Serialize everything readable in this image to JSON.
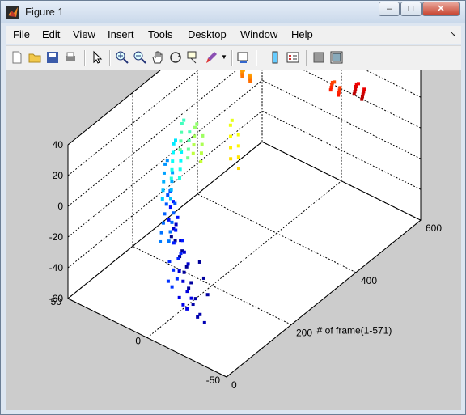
{
  "window": {
    "title": "Figure 1",
    "minimize": "–",
    "maximize": "□",
    "close": "✕"
  },
  "menu": [
    "File",
    "Edit",
    "View",
    "Insert",
    "Tools",
    "Desktop",
    "Window",
    "Help"
  ],
  "toolbar": [
    "new-figure-icon",
    "open-file-icon",
    "save-icon",
    "print-icon",
    "pointer-icon",
    "zoom-in-icon",
    "zoom-out-icon",
    "pan-icon",
    "rotate-3d-icon",
    "data-cursor-icon",
    "brush-icon",
    "link-plot-icon",
    "colorbar-icon",
    "legend-icon",
    "hide-plot-tools-icon",
    "show-plot-tools-icon"
  ],
  "chart_data": {
    "type": "scatter",
    "title": "",
    "xlabel": "# of frame(1-571)",
    "ylabel": "",
    "zlabel": "",
    "x_ticks": [
      "0",
      "200",
      "400",
      "600"
    ],
    "y_ticks": [
      "-50",
      "0",
      "50"
    ],
    "z_ticks": [
      "-60",
      "-40",
      "-20",
      "0",
      "20",
      "40"
    ],
    "xlim": [
      0,
      600
    ],
    "ylim": [
      -50,
      50
    ],
    "zlim": [
      -60,
      40
    ],
    "grid": true,
    "colormap": "jet",
    "points": [
      [
        10,
        -20,
        5
      ],
      [
        12,
        -18,
        0
      ],
      [
        14,
        -22,
        -5
      ],
      [
        16,
        -20,
        -10
      ],
      [
        18,
        -24,
        -15
      ],
      [
        20,
        -22,
        -20
      ],
      [
        22,
        -26,
        -25
      ],
      [
        24,
        -24,
        -30
      ],
      [
        26,
        -28,
        -35
      ],
      [
        28,
        -26,
        -38
      ],
      [
        30,
        -30,
        -40
      ],
      [
        15,
        -30,
        2
      ],
      [
        18,
        -32,
        -8
      ],
      [
        20,
        -34,
        -18
      ],
      [
        8,
        -16,
        10
      ],
      [
        6,
        -14,
        12
      ],
      [
        40,
        -10,
        12
      ],
      [
        42,
        -8,
        8
      ],
      [
        44,
        -12,
        2
      ],
      [
        46,
        -14,
        -5
      ],
      [
        48,
        -16,
        -12
      ],
      [
        50,
        -10,
        -20
      ],
      [
        52,
        -12,
        -26
      ],
      [
        55,
        -14,
        -32
      ],
      [
        58,
        -16,
        -36
      ],
      [
        60,
        -8,
        -40
      ],
      [
        62,
        -10,
        -44
      ],
      [
        64,
        -12,
        -46
      ],
      [
        80,
        0,
        15
      ],
      [
        82,
        2,
        10
      ],
      [
        84,
        -2,
        5
      ],
      [
        86,
        4,
        0
      ],
      [
        88,
        0,
        -5
      ],
      [
        90,
        -4,
        -10
      ],
      [
        92,
        2,
        -15
      ],
      [
        94,
        -2,
        -20
      ],
      [
        96,
        0,
        -25
      ],
      [
        98,
        6,
        -30
      ],
      [
        100,
        4,
        -35
      ],
      [
        102,
        2,
        -40
      ],
      [
        104,
        8,
        -45
      ],
      [
        106,
        6,
        -48
      ],
      [
        120,
        10,
        10
      ],
      [
        122,
        12,
        6
      ],
      [
        125,
        8,
        2
      ],
      [
        128,
        14,
        -2
      ],
      [
        130,
        10,
        -6
      ],
      [
        132,
        16,
        -10
      ],
      [
        135,
        12,
        -14
      ],
      [
        138,
        18,
        -18
      ],
      [
        140,
        14,
        -22
      ],
      [
        142,
        20,
        -26
      ],
      [
        145,
        16,
        -30
      ],
      [
        148,
        22,
        -34
      ],
      [
        160,
        20,
        18
      ],
      [
        163,
        22,
        14
      ],
      [
        166,
        18,
        10
      ],
      [
        170,
        24,
        6
      ],
      [
        174,
        20,
        2
      ],
      [
        178,
        26,
        -2
      ],
      [
        182,
        22,
        -6
      ],
      [
        186,
        28,
        -10
      ],
      [
        190,
        24,
        -14
      ],
      [
        194,
        30,
        -18
      ],
      [
        210,
        25,
        20
      ],
      [
        214,
        27,
        16
      ],
      [
        218,
        23,
        12
      ],
      [
        222,
        29,
        8
      ],
      [
        226,
        25,
        4
      ],
      [
        230,
        31,
        0
      ],
      [
        234,
        27,
        -4
      ],
      [
        238,
        33,
        -8
      ],
      [
        242,
        29,
        -12
      ],
      [
        246,
        35,
        -16
      ],
      [
        260,
        30,
        22
      ],
      [
        264,
        32,
        18
      ],
      [
        268,
        28,
        14
      ],
      [
        272,
        34,
        10
      ],
      [
        276,
        30,
        6
      ],
      [
        280,
        36,
        2
      ],
      [
        284,
        32,
        -2
      ],
      [
        288,
        38,
        -6
      ],
      [
        292,
        34,
        -10
      ],
      [
        310,
        32,
        10
      ],
      [
        314,
        34,
        6
      ],
      [
        318,
        30,
        2
      ],
      [
        322,
        36,
        -2
      ],
      [
        326,
        32,
        -6
      ],
      [
        330,
        38,
        -10
      ],
      [
        334,
        34,
        -14
      ],
      [
        338,
        40,
        -18
      ],
      [
        342,
        36,
        -22
      ],
      [
        360,
        20,
        10
      ],
      [
        365,
        22,
        5
      ],
      [
        370,
        18,
        0
      ],
      [
        375,
        24,
        -5
      ],
      [
        380,
        20,
        -10
      ],
      [
        385,
        26,
        -15
      ],
      [
        390,
        22,
        -20
      ],
      [
        395,
        28,
        -25
      ],
      [
        400,
        24,
        -30
      ],
      [
        420,
        25,
        30
      ],
      [
        425,
        27,
        28
      ],
      [
        430,
        23,
        26
      ],
      [
        435,
        29,
        24
      ],
      [
        440,
        25,
        22
      ],
      [
        445,
        31,
        20
      ],
      [
        450,
        27,
        18
      ],
      [
        455,
        33,
        16
      ],
      [
        460,
        29,
        14
      ],
      [
        480,
        -20,
        35
      ],
      [
        484,
        -18,
        33
      ],
      [
        488,
        -22,
        31
      ],
      [
        492,
        -16,
        29
      ],
      [
        496,
        -20,
        27
      ],
      [
        500,
        -14,
        25
      ],
      [
        504,
        -18,
        23
      ],
      [
        508,
        -12,
        21
      ],
      [
        512,
        -16,
        19
      ],
      [
        530,
        -25,
        28
      ],
      [
        534,
        -23,
        26
      ],
      [
        538,
        -27,
        24
      ],
      [
        542,
        -21,
        22
      ],
      [
        546,
        -25,
        20
      ],
      [
        550,
        -19,
        18
      ],
      [
        554,
        -23,
        16
      ],
      [
        558,
        -17,
        14
      ],
      [
        562,
        -21,
        12
      ],
      [
        566,
        -15,
        10
      ],
      [
        570,
        -19,
        8
      ]
    ]
  }
}
